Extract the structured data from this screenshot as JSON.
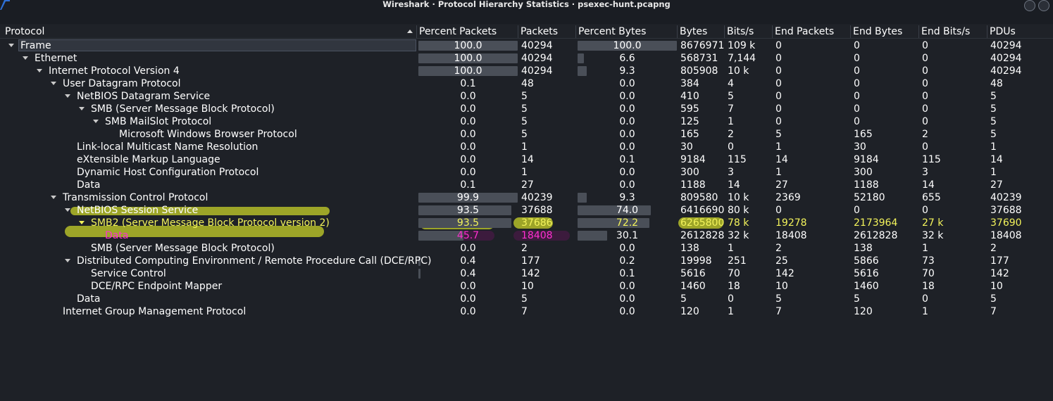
{
  "window": {
    "title": "Wireshark · Protocol Hierarchy Statistics · psexec-hunt.pcapng"
  },
  "columns": [
    "Protocol",
    "Percent Packets",
    "Packets",
    "Percent Bytes",
    "Bytes",
    "Bits/s",
    "End Packets",
    "End Bytes",
    "End Bits/s",
    "PDUs"
  ],
  "colors": {
    "background": "#1e2127",
    "highlight_yellow": "#cfd82a",
    "highlight_magenta": "#ff2fd0",
    "bar": "#4a4f58"
  },
  "rows": [
    {
      "name": "Frame",
      "level": 0,
      "expander": true,
      "pct_packets": "100.0",
      "pp_fill": 1.0,
      "packets": "40294",
      "pct_bytes": "100.0",
      "pb_fill": 1.0,
      "bytes": "8676971",
      "bits": "109 k",
      "end_packets": "0",
      "end_bytes": "0",
      "end_bits": "0",
      "pdus": "40294",
      "selected": true
    },
    {
      "name": "Ethernet",
      "level": 1,
      "expander": true,
      "pct_packets": "100.0",
      "pp_fill": 1.0,
      "packets": "40294",
      "pct_bytes": "6.6",
      "pb_fill": 0.066,
      "bytes": "568731",
      "bits": "7,144",
      "end_packets": "0",
      "end_bytes": "0",
      "end_bits": "0",
      "pdus": "40294"
    },
    {
      "name": "Internet Protocol Version 4",
      "level": 2,
      "expander": true,
      "pct_packets": "100.0",
      "pp_fill": 1.0,
      "packets": "40294",
      "pct_bytes": "9.3",
      "pb_fill": 0.093,
      "bytes": "805908",
      "bits": "10 k",
      "end_packets": "0",
      "end_bytes": "0",
      "end_bits": "0",
      "pdus": "40294"
    },
    {
      "name": "User Datagram Protocol",
      "level": 3,
      "expander": true,
      "pct_packets": "0.1",
      "pp_fill": 0.001,
      "packets": "48",
      "pct_bytes": "0.0",
      "pb_fill": 0,
      "bytes": "384",
      "bits": "4",
      "end_packets": "0",
      "end_bytes": "0",
      "end_bits": "0",
      "pdus": "48"
    },
    {
      "name": "NetBIOS Datagram Service",
      "level": 4,
      "expander": true,
      "pct_packets": "0.0",
      "pp_fill": 0,
      "packets": "5",
      "pct_bytes": "0.0",
      "pb_fill": 0,
      "bytes": "410",
      "bits": "5",
      "end_packets": "0",
      "end_bytes": "0",
      "end_bits": "0",
      "pdus": "5"
    },
    {
      "name": "SMB (Server Message Block Protocol)",
      "level": 5,
      "expander": true,
      "pct_packets": "0.0",
      "pp_fill": 0,
      "packets": "5",
      "pct_bytes": "0.0",
      "pb_fill": 0,
      "bytes": "595",
      "bits": "7",
      "end_packets": "0",
      "end_bytes": "0",
      "end_bits": "0",
      "pdus": "5"
    },
    {
      "name": "SMB MailSlot Protocol",
      "level": 6,
      "expander": true,
      "pct_packets": "0.0",
      "pp_fill": 0,
      "packets": "5",
      "pct_bytes": "0.0",
      "pb_fill": 0,
      "bytes": "125",
      "bits": "1",
      "end_packets": "0",
      "end_bytes": "0",
      "end_bits": "0",
      "pdus": "5"
    },
    {
      "name": "Microsoft Windows Browser Protocol",
      "level": 7,
      "expander": false,
      "pct_packets": "0.0",
      "pp_fill": 0,
      "packets": "5",
      "pct_bytes": "0.0",
      "pb_fill": 0,
      "bytes": "165",
      "bits": "2",
      "end_packets": "5",
      "end_bytes": "165",
      "end_bits": "2",
      "pdus": "5"
    },
    {
      "name": "Link-local Multicast Name Resolution",
      "level": 4,
      "expander": false,
      "pct_packets": "0.0",
      "pp_fill": 0,
      "packets": "1",
      "pct_bytes": "0.0",
      "pb_fill": 0,
      "bytes": "30",
      "bits": "0",
      "end_packets": "1",
      "end_bytes": "30",
      "end_bits": "0",
      "pdus": "1"
    },
    {
      "name": "eXtensible Markup Language",
      "level": 4,
      "expander": false,
      "pct_packets": "0.0",
      "pp_fill": 0,
      "packets": "14",
      "pct_bytes": "0.1",
      "pb_fill": 0.001,
      "bytes": "9184",
      "bits": "115",
      "end_packets": "14",
      "end_bytes": "9184",
      "end_bits": "115",
      "pdus": "14"
    },
    {
      "name": "Dynamic Host Configuration Protocol",
      "level": 4,
      "expander": false,
      "pct_packets": "0.0",
      "pp_fill": 0,
      "packets": "1",
      "pct_bytes": "0.0",
      "pb_fill": 0,
      "bytes": "300",
      "bits": "3",
      "end_packets": "1",
      "end_bytes": "300",
      "end_bits": "3",
      "pdus": "1"
    },
    {
      "name": "Data",
      "level": 4,
      "expander": false,
      "pct_packets": "0.1",
      "pp_fill": 0.001,
      "packets": "27",
      "pct_bytes": "0.0",
      "pb_fill": 0,
      "bytes": "1188",
      "bits": "14",
      "end_packets": "27",
      "end_bytes": "1188",
      "end_bits": "14",
      "pdus": "27"
    },
    {
      "name": "Transmission Control Protocol",
      "level": 3,
      "expander": true,
      "pct_packets": "99.9",
      "pp_fill": 0.999,
      "packets": "40239",
      "pct_bytes": "9.3",
      "pb_fill": 0.093,
      "bytes": "809580",
      "bits": "10 k",
      "end_packets": "2369",
      "end_bytes": "52180",
      "end_bits": "655",
      "pdus": "40239"
    },
    {
      "name": "NetBIOS Session Service",
      "level": 4,
      "expander": true,
      "pct_packets": "93.5",
      "pp_fill": 0.935,
      "packets": "37688",
      "pct_bytes": "74.0",
      "pb_fill": 0.74,
      "bytes": "6416690",
      "bits": "80 k",
      "end_packets": "0",
      "end_bytes": "0",
      "end_bits": "0",
      "pdus": "37688"
    },
    {
      "name": "SMB2 (Server Message Block Protocol version 2)",
      "level": 5,
      "expander": true,
      "pct_packets": "93.5",
      "pp_fill": 0.935,
      "packets": "37686",
      "pct_bytes": "72.2",
      "pb_fill": 0.722,
      "bytes": "6265800",
      "bits": "78 k",
      "end_packets": "19278",
      "end_bytes": "2173964",
      "end_bits": "27 k",
      "pdus": "37690",
      "style": "smb2"
    },
    {
      "name": "Data",
      "level": 6,
      "expander": false,
      "pct_packets": "45.7",
      "pp_fill": 0.457,
      "packets": "18408",
      "pct_bytes": "30.1",
      "pb_fill": 0.301,
      "bytes": "2612828",
      "bits": "32 k",
      "end_packets": "18408",
      "end_bytes": "2612828",
      "end_bits": "32 k",
      "pdus": "18408",
      "style": "smb2data"
    },
    {
      "name": "SMB (Server Message Block Protocol)",
      "level": 5,
      "expander": false,
      "pct_packets": "0.0",
      "pp_fill": 0,
      "packets": "2",
      "pct_bytes": "0.0",
      "pb_fill": 0,
      "bytes": "138",
      "bits": "1",
      "end_packets": "2",
      "end_bytes": "138",
      "end_bits": "1",
      "pdus": "2"
    },
    {
      "name": "Distributed Computing Environment / Remote Procedure Call (DCE/RPC)",
      "level": 4,
      "expander": true,
      "pct_packets": "0.4",
      "pp_fill": 0.004,
      "packets": "177",
      "pct_bytes": "0.2",
      "pb_fill": 0.002,
      "bytes": "19998",
      "bits": "251",
      "end_packets": "25",
      "end_bytes": "5866",
      "end_bits": "73",
      "pdus": "177"
    },
    {
      "name": "Service Control",
      "level": 5,
      "expander": false,
      "pct_packets": "0.4",
      "pp_fill": 0.004,
      "packets": "142",
      "pct_bytes": "0.1",
      "pb_fill": 0.001,
      "bytes": "5616",
      "bits": "70",
      "end_packets": "142",
      "end_bytes": "5616",
      "end_bits": "70",
      "pdus": "142"
    },
    {
      "name": "DCE/RPC Endpoint Mapper",
      "level": 5,
      "expander": false,
      "pct_packets": "0.0",
      "pp_fill": 0,
      "packets": "10",
      "pct_bytes": "0.0",
      "pb_fill": 0,
      "bytes": "1460",
      "bits": "18",
      "end_packets": "10",
      "end_bytes": "1460",
      "end_bits": "18",
      "pdus": "10"
    },
    {
      "name": "Data",
      "level": 4,
      "expander": false,
      "pct_packets": "0.0",
      "pp_fill": 0,
      "packets": "5",
      "pct_bytes": "0.0",
      "pb_fill": 0,
      "bytes": "5",
      "bits": "0",
      "end_packets": "5",
      "end_bytes": "5",
      "end_bits": "0",
      "pdus": "5"
    },
    {
      "name": "Internet Group Management Protocol",
      "level": 3,
      "expander": false,
      "pct_packets": "0.0",
      "pp_fill": 0,
      "packets": "7",
      "pct_bytes": "0.0",
      "pb_fill": 0,
      "bytes": "120",
      "bits": "1",
      "end_packets": "7",
      "end_bytes": "120",
      "end_bits": "1",
      "pdus": "7"
    }
  ]
}
